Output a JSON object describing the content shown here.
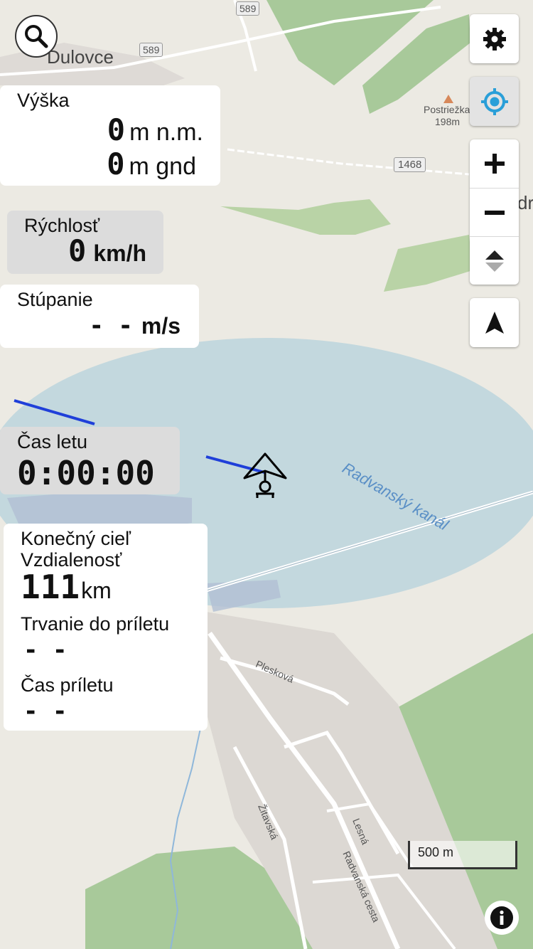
{
  "map": {
    "town_label": "Dulovce",
    "road_labels": [
      "589",
      "589",
      "1468"
    ],
    "peak_name": "Postriežka",
    "peak_elevation": "198m",
    "water_label": "Radvanský kanál",
    "street_labels": [
      "Plesková",
      "Žitavská",
      "Lesná",
      "Radvanská cesta"
    ],
    "edge_label": "dr",
    "scale_label": "500 m"
  },
  "altitude": {
    "label": "Výška",
    "msl_value": "0",
    "msl_unit": "m n.m.",
    "gnd_value": "0",
    "gnd_unit": "m gnd"
  },
  "speed": {
    "label": "Rýchlosť",
    "value": "0",
    "unit": "km/h"
  },
  "climb": {
    "label": "Stúpanie",
    "value": "- -",
    "unit": "m/s"
  },
  "flight_time": {
    "label": "Čas letu",
    "value": "0:00:00"
  },
  "goal": {
    "title": "Konečný cieľ",
    "distance_label": "Vzdialenosť",
    "distance_value": "111",
    "distance_unit": "km",
    "duration_label": "Trvanie do príletu",
    "duration_value": "- -",
    "arrival_label": "Čas príletu",
    "arrival_value": "- -"
  },
  "icons": {
    "search": "search-icon",
    "settings": "gear-icon",
    "locate": "gps-locate-icon",
    "zoom_in": "plus-icon",
    "zoom_out": "minus-icon",
    "tilt": "tilt-icon",
    "compass": "navigation-arrow-icon",
    "info": "info-icon",
    "glider": "hang-glider-icon"
  },
  "colors": {
    "accent": "#2A9FD8",
    "track": "#1F3FD9",
    "water": "#BFD6DD",
    "forest": "#A8C99A"
  }
}
